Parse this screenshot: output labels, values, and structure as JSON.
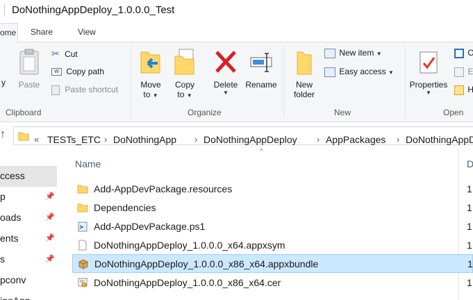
{
  "window": {
    "title": "DoNothingAppDeploy_1.0.0.0_Test"
  },
  "tabs": [
    {
      "label": "ome"
    },
    {
      "label": "Share"
    },
    {
      "label": "View"
    }
  ],
  "ribbon": {
    "clipboard": {
      "copy_label": "y",
      "paste_label": "Paste",
      "cut_label": "Cut",
      "copy_path_label": "Copy path",
      "paste_shortcut_label": "Paste shortcut",
      "group_label": "Clipboard"
    },
    "organize": {
      "move_to_label": "Move",
      "move_to_label2": "to",
      "copy_to_label": "Copy",
      "copy_to_label2": "to",
      "delete_label": "Delete",
      "rename_label": "Rename",
      "group_label": "Organize"
    },
    "new": {
      "new_folder_label": "New",
      "new_folder_label2": "folder",
      "new_item_label": "New item",
      "easy_access_label": "Easy access",
      "group_label": "New"
    },
    "open": {
      "properties_label": "Properties",
      "open_small_1": "O",
      "open_small_2": "E",
      "open_small_3": "H",
      "group_label": "Open"
    }
  },
  "address": {
    "overflow": "«",
    "crumbs": [
      "TESTs_ETC",
      "DoNothingApp",
      "DoNothingAppDeploy",
      "AppPackages",
      "DoNothingAppD"
    ]
  },
  "nav": {
    "items": [
      {
        "label": "ccess",
        "pinned": false
      },
      {
        "label": "p",
        "pinned": true
      },
      {
        "label": "oads",
        "pinned": true
      },
      {
        "label": "ents",
        "pinned": true
      },
      {
        "label": "s",
        "pinned": true
      },
      {
        "label": "pconv",
        "pinned": false
      },
      {
        "label": "ingApp",
        "pinned": false
      }
    ]
  },
  "content": {
    "col_name": "Name",
    "col_date": "D",
    "files": [
      {
        "name": "Add-AppDevPackage.resources",
        "type": "folder",
        "date": "1"
      },
      {
        "name": "Dependencies",
        "type": "folder",
        "date": "1"
      },
      {
        "name": "Add-AppDevPackage.ps1",
        "type": "ps1",
        "date": "1"
      },
      {
        "name": "DoNothingAppDeploy_1.0.0.0_x64.appxsym",
        "type": "file",
        "date": "1"
      },
      {
        "name": "DoNothingAppDeploy_1.0.0.0_x86_x64.appxbundle",
        "type": "package",
        "date": "1",
        "selected": true
      },
      {
        "name": "DoNothingAppDeploy_1.0.0.0_x86_x64.cer",
        "type": "cert",
        "date": "1"
      }
    ]
  }
}
